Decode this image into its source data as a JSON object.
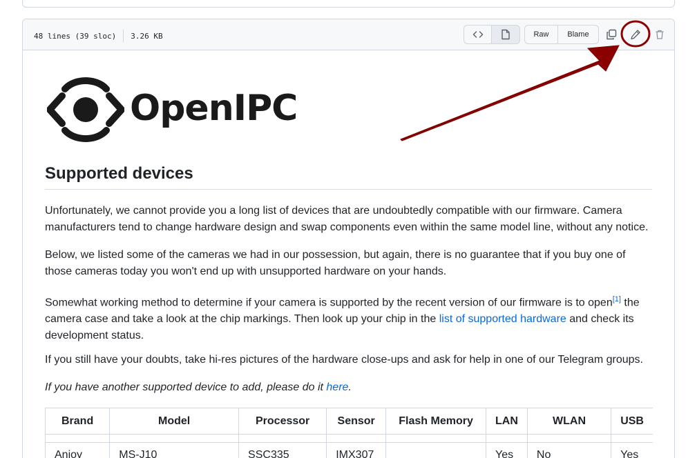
{
  "file_header": {
    "lines": "48 lines (39 sloc)",
    "size": "3.26 KB",
    "raw_label": "Raw",
    "blame_label": "Blame",
    "icons": [
      "code-icon",
      "file-icon",
      "copy-icon",
      "pencil-icon",
      "trash-icon"
    ]
  },
  "logo": {
    "text": "OpenIPC"
  },
  "heading": "Supported devices",
  "paragraphs": {
    "p1": "Unfortunately, we cannot provide you a long list of devices that are undoubtedly compatible with our firmware. Camera manufacturers tend to change hardware design and swap components even within the same model line, without any notice.",
    "p2": "Below, we listed some of the cameras we had in our possession, but again, there is no guarantee that if you buy one of those cameras today you won't end up with unsupported hardware on your hands.",
    "p3_before": "Somewhat working method to determine if your camera is supported by the recent version of our firmware is to open",
    "p3_sup": "[1]",
    "p3_middle": " the camera case and take a look at the chip markings. Then look up your chip in the ",
    "p3_link": "list of supported hardware",
    "p3_after": " and check its development status.",
    "p4": "If you still have your doubts, take hi-res pictures of the hardware close-ups and ask for help in one of our Telegram groups.",
    "p5_before": "If you have another supported device to add, please do it ",
    "p5_link": "here",
    "p5_after": "."
  },
  "table": {
    "headers": [
      "Brand",
      "Model",
      "Processor",
      "Sensor",
      "Flash Memory",
      "LAN",
      "WLAN",
      "USB"
    ],
    "rows": [
      [
        "Anjoy",
        "MS-J10",
        "SSC335",
        "IMX307",
        "",
        "Yes",
        "No",
        "Yes"
      ]
    ]
  },
  "colors": {
    "accent_link": "#0969da",
    "annotation_red": "#8b0000",
    "border": "#d0d7de"
  }
}
